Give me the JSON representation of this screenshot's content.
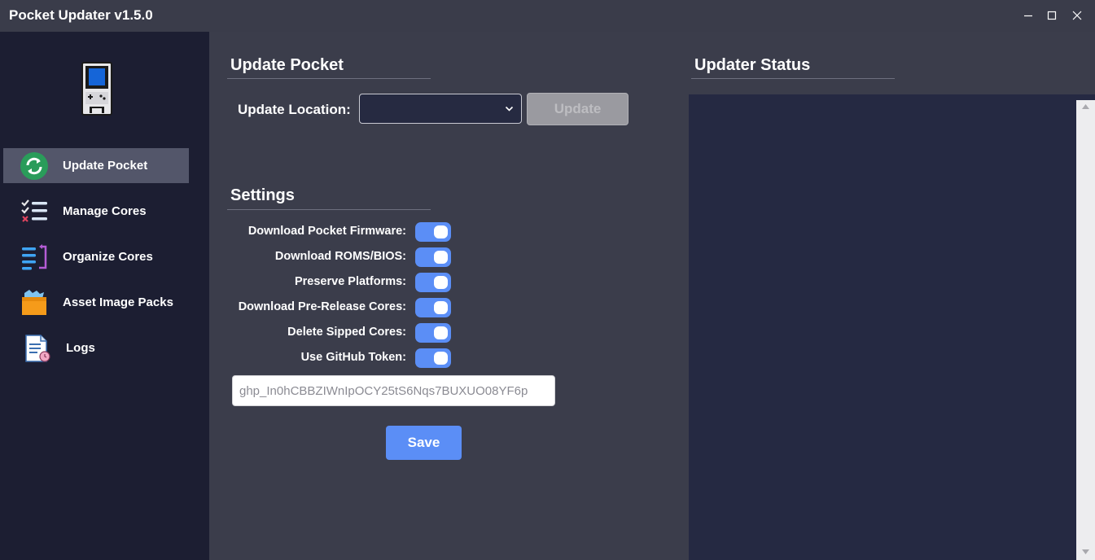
{
  "window": {
    "title": "Pocket Updater v1.5.0"
  },
  "sidebar": {
    "items": [
      {
        "label": "Update Pocket",
        "icon": "refresh-icon",
        "active": true
      },
      {
        "label": "Manage Cores",
        "icon": "checklist-icon",
        "active": false
      },
      {
        "label": "Organize Cores",
        "icon": "reorder-icon",
        "active": false
      },
      {
        "label": "Asset Image Packs",
        "icon": "box-icon",
        "active": false
      },
      {
        "label": "Logs",
        "icon": "log-document-icon",
        "active": false
      }
    ]
  },
  "update_section": {
    "title": "Update Pocket",
    "location_label": "Update Location:",
    "location_value": "",
    "update_button": "Update"
  },
  "settings": {
    "title": "Settings",
    "toggles": [
      {
        "label": "Download Pocket Firmware:",
        "on": true
      },
      {
        "label": "Download ROMS/BIOS:",
        "on": true
      },
      {
        "label": "Preserve Platforms:",
        "on": true
      },
      {
        "label": "Download Pre-Release Cores:",
        "on": true
      },
      {
        "label": "Delete Sipped Cores:",
        "on": true
      },
      {
        "label": "Use GitHub Token:",
        "on": true
      }
    ],
    "token_placeholder": "ghp_In0hCBBZIWnIpOCY25tS6Nqs7BUXUO08YF6p",
    "save_button": "Save"
  },
  "status": {
    "title": "Updater Status"
  },
  "colors": {
    "accent": "#5b8ef6",
    "sidebar_bg": "#1c1e32",
    "main_bg": "#3b3d4b",
    "status_bg": "#252942"
  }
}
